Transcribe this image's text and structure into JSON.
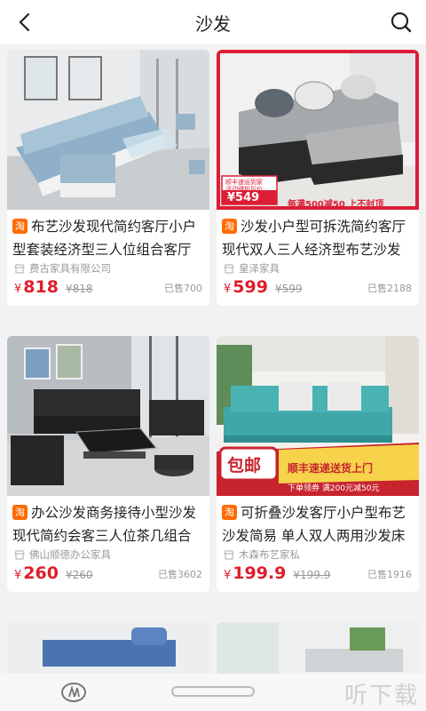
{
  "header": {
    "title": "沙发"
  },
  "products": [
    {
      "tag": "淘",
      "title": "布艺沙发现代简约客厅小户型套装经济型三人位组合客厅家具",
      "shop": "费古家具有限公司",
      "currency": "¥",
      "price": "818",
      "old_price": "¥818",
      "sold": "已售700"
    },
    {
      "tag": "淘",
      "title": "沙发小户型可拆洗简约客厅现代双人三人经济型布艺沙发",
      "shop": "皇泽家具",
      "currency": "¥",
      "price": "599",
      "old_price": "¥599",
      "sold": "已售2188",
      "badge": {
        "line1": "顺丰速运到家",
        "line2": "活动键折后价:",
        "price": "¥549",
        "banner": "每满500减50 上不封顶"
      }
    },
    {
      "tag": "淘",
      "title": "办公沙发商务接待小型沙发现代简约会客三人位茶几组合",
      "shop": "佛山顺德办公家具",
      "currency": "¥",
      "price": "260",
      "old_price": "¥260",
      "sold": "已售3602"
    },
    {
      "tag": "淘",
      "title": "可折叠沙发客厅小户型布艺沙发简易 单人双人两用沙发床",
      "shop": "木森布艺家私",
      "currency": "¥",
      "price": "199.9",
      "old_price": "¥199.9",
      "sold": "已售1916",
      "badge": {
        "free": "包邮",
        "line1": "顺丰速递送货上门",
        "line2": "下单领券 满200元减50元"
      }
    }
  ],
  "watermark": "听下载"
}
